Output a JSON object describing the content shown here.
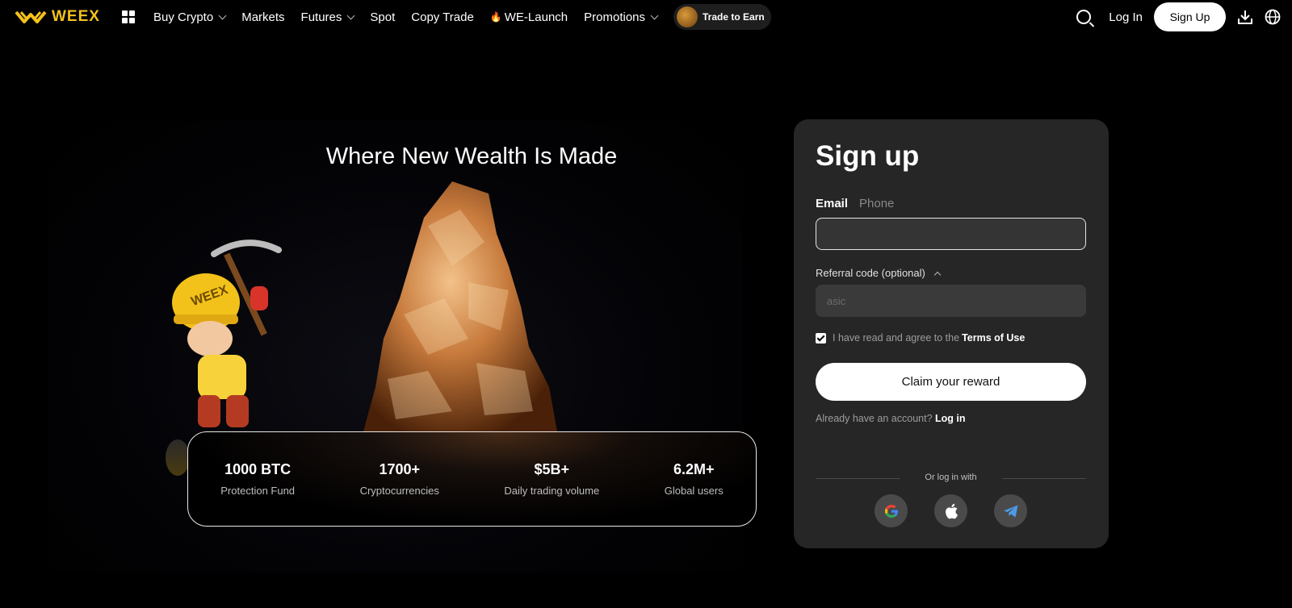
{
  "nav": {
    "logo": "WEEX",
    "items": [
      {
        "label": "Buy Crypto",
        "dropdown": true
      },
      {
        "label": "Markets",
        "dropdown": false
      },
      {
        "label": "Futures",
        "dropdown": true
      },
      {
        "label": "Spot",
        "dropdown": false
      },
      {
        "label": "Copy Trade",
        "dropdown": false
      },
      {
        "label": "WE-Launch",
        "dropdown": false
      },
      {
        "label": "Promotions",
        "dropdown": true
      }
    ],
    "trade_to_earn": "Trade to Earn",
    "login": "Log In",
    "signup": "Sign Up"
  },
  "hero": {
    "title": "Where New Wealth Is Made",
    "stats": [
      {
        "value": "1000 BTC",
        "label": "Protection Fund"
      },
      {
        "value": "1700+",
        "label": "Cryptocurrencies"
      },
      {
        "value": "$5B+",
        "label": "Daily trading volume"
      },
      {
        "value": "6.2M+",
        "label": "Global users"
      }
    ]
  },
  "signup": {
    "title": "Sign up",
    "tabs": {
      "email": "Email",
      "phone": "Phone"
    },
    "email_value": "",
    "referral_label": "Referral code (optional)",
    "referral_placeholder": "asic",
    "agree_text": "I have read and agree to the",
    "terms": "Terms of Use",
    "claim": "Claim your reward",
    "already": "Already have an account?",
    "login": "Log in",
    "or": "Or log in with"
  },
  "colors": {
    "accent": "#f4c21b",
    "card": "#262626"
  }
}
